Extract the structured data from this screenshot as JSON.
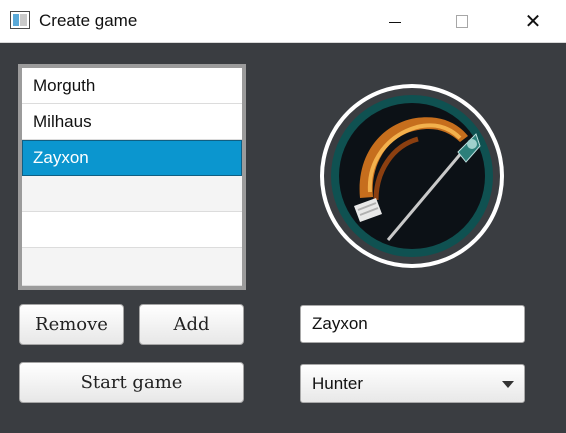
{
  "window": {
    "title": "Create game"
  },
  "icons": {
    "app": "app-window-icon",
    "minimize": "minimize-icon",
    "maximize": "maximize-icon",
    "close": "close-icon",
    "chevron": "chevron-down-icon",
    "class": "hunter-bow-icon"
  },
  "players": {
    "items": [
      {
        "label": "Morguth"
      },
      {
        "label": "Milhaus"
      },
      {
        "label": "Zayxon",
        "selected": true
      },
      {
        "label": ""
      },
      {
        "label": ""
      },
      {
        "label": ""
      }
    ]
  },
  "buttons": {
    "remove": "Remove",
    "add": "Add",
    "start": "Start game"
  },
  "editor": {
    "name_value": "Zayxon",
    "class_selected": "Hunter"
  },
  "colors": {
    "selection": "#0b96cf",
    "background": "#3a3d41",
    "ring": "#ffffff"
  }
}
